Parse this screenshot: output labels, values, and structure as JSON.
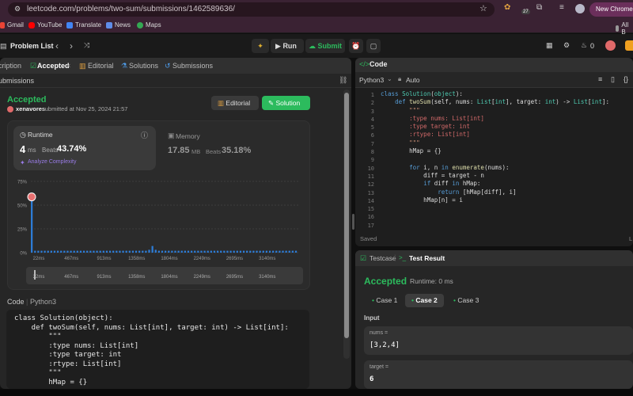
{
  "browser": {
    "url": "leetcode.com/problems/two-sum/submissions/1462589636/",
    "bookmarks": [
      "Gmail",
      "YouTube",
      "Translate",
      "News",
      "Maps"
    ],
    "bookmarks_right": "All B",
    "chrome_badge": "New Chrome av",
    "ext_count": "27"
  },
  "topbar": {
    "problem_list": "Problem List",
    "run": "Run",
    "submit": "Submit",
    "streak": "0"
  },
  "left": {
    "tabs": [
      "cription",
      "Accepted",
      "Editorial",
      "Solutions",
      "Submissions"
    ],
    "sub_title": "ubmissions",
    "status": "Accepted",
    "user": "xenavores",
    "submitted": "submitted at Nov 25, 2024 21:57",
    "editorial_btn": "Editorial",
    "solution_btn": "Solution",
    "runtime_label": "Runtime",
    "runtime_value": "4",
    "runtime_unit": "ms",
    "runtime_beats_label": "Beats",
    "runtime_beats": "43.74%",
    "analyze": "Analyze Complexity",
    "memory_label": "Memory",
    "memory_value": "17.85",
    "memory_unit": "MB",
    "memory_beats_label": "Beats",
    "memory_beats": "35.18%",
    "code_label": "Code",
    "code_lang": "Python3",
    "code": "class Solution(object):\n    def twoSum(self, nums: List[int], target: int) -> List[int]:\n        \"\"\"\n        :type nums: List[int]\n        :type target: int\n        :rtype: List[int]\n        \"\"\"\n        hMap = {}"
  },
  "chart_data": {
    "type": "bar",
    "y_ticks": [
      "75%",
      "50%",
      "25%",
      "0%"
    ],
    "x_ticks": [
      "22ms",
      "467ms",
      "913ms",
      "1358ms",
      "1804ms",
      "2249ms",
      "2695ms",
      "3140ms"
    ],
    "ylim": [
      0,
      75
    ],
    "values": [
      62,
      2,
      2,
      2,
      2,
      2,
      2,
      2,
      2,
      2,
      2,
      2,
      2,
      2,
      2,
      2,
      2,
      2,
      2,
      2,
      2,
      2,
      2,
      2,
      2,
      2,
      2,
      2,
      2,
      2,
      2,
      2,
      2,
      2,
      2,
      2,
      3,
      7,
      3,
      2,
      2,
      2,
      2,
      2,
      2,
      2,
      2,
      2,
      2,
      2,
      2,
      2,
      2,
      2,
      2,
      2,
      2,
      2,
      2,
      2,
      2,
      2,
      2,
      2,
      2,
      2,
      2,
      2,
      2,
      2,
      2,
      2,
      2,
      2,
      2,
      2,
      2,
      2,
      2,
      2,
      2,
      2
    ],
    "highlight_index": 0,
    "grid": true,
    "color": "#2d7cd6"
  },
  "code_panel": {
    "title": "Code",
    "lang": "Python3",
    "mode": "Auto",
    "saved": "Saved",
    "line_numbers": "1\n2\n3\n4\n5\n6\n7\n8\n9\n10\n11\n12\n13\n14\n15\n16\n17"
  },
  "test": {
    "tab_testcase": "Testcase",
    "tab_result": "Test Result",
    "status": "Accepted",
    "runtime": "Runtime: 0 ms",
    "cases": [
      "Case 1",
      "Case 2",
      "Case 3"
    ],
    "input_label": "Input",
    "nums_label": "nums =",
    "nums_value": "[3,2,4]",
    "target_label": "target =",
    "target_value": "6"
  }
}
